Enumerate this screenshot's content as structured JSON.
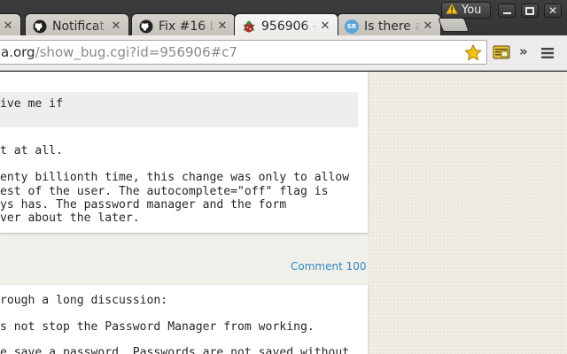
{
  "tabs": [
    {
      "title": "",
      "icon": "generic-page-icon",
      "active": false
    },
    {
      "title": "Notificat",
      "icon": "github-icon",
      "active": false
    },
    {
      "title": "Fix #16 b",
      "icon": "github-icon",
      "active": false
    },
    {
      "title": "956906 –",
      "icon": "bugzilla-bug-icon",
      "active": true
    },
    {
      "title": "Is there a",
      "icon": "superuser-icon",
      "active": false,
      "icon_text": "SR"
    }
  ],
  "profile": {
    "label": "You"
  },
  "omnibox": {
    "domain": "a.org",
    "path": "/show_bug.cgi?id=956906#c7"
  },
  "content": {
    "quote_lines": [
      "ive me if"
    ],
    "comment1_lines": [
      "t at all.",
      "",
      "enty billionth time, this change was only to allow",
      "est of the user. The autocomplete=\"off\" flag is",
      "ys has. The password manager and the form",
      "ver about the later."
    ],
    "comment_label": "Comment 100",
    "comment2_lines": [
      "rough a long discussion:",
      "",
      "s not stop the Password Manager from working.",
      "",
      "e save a password. Passwords are not saved without"
    ]
  },
  "colors": {
    "link": "#2f88c4",
    "tabstrip": "#3a3a3a",
    "page_bg": "#f1efea"
  }
}
